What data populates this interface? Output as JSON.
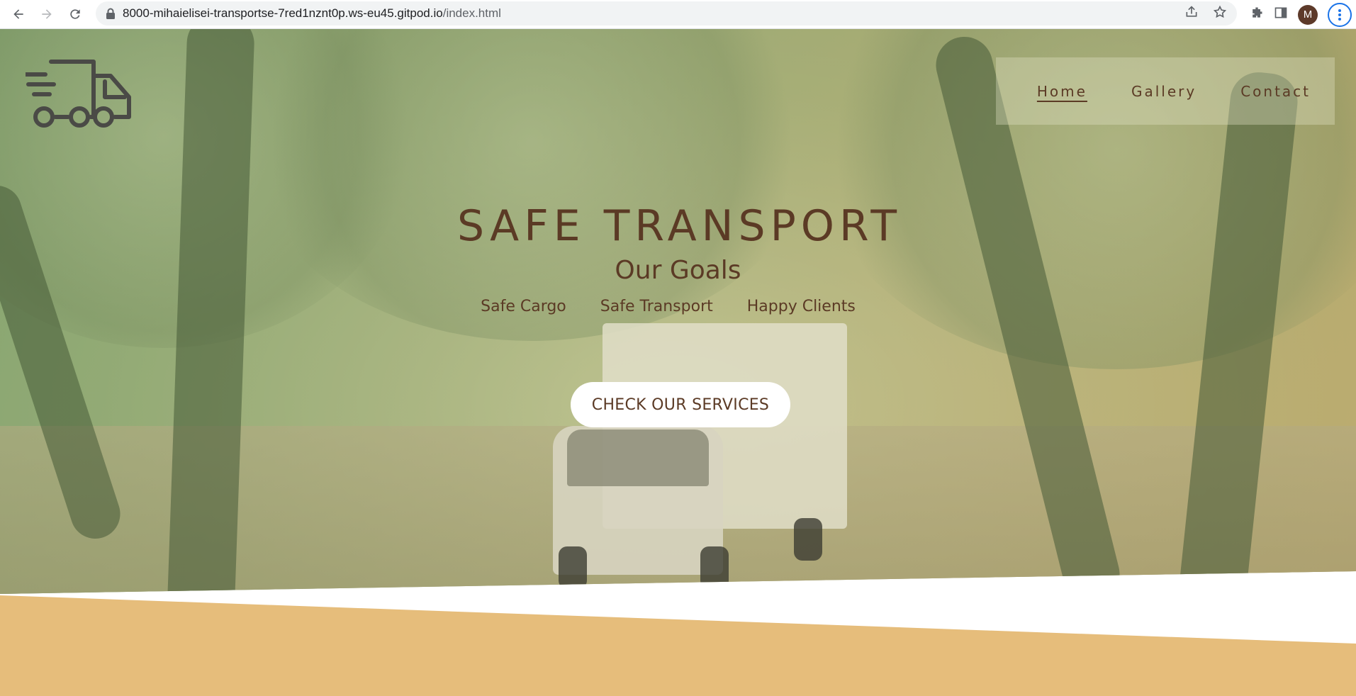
{
  "browser": {
    "url_host": "8000-mihaielisei-transportse-7red1nznt0p.ws-eu45.gitpod.io",
    "url_path": "/index.html",
    "profile_initial": "M",
    "accent_color": "#1a73e8"
  },
  "site": {
    "logo_icon": "delivery-truck-icon",
    "nav": {
      "items": [
        {
          "label": "Home",
          "active": true
        },
        {
          "label": "Gallery",
          "active": false
        },
        {
          "label": "Contact",
          "active": false
        }
      ]
    },
    "hero": {
      "title": "SAFE TRANSPORT",
      "subtitle": "Our Goals",
      "goals": [
        "Safe Cargo",
        "Safe Transport",
        "Happy Clients"
      ],
      "cta_label": "CHECK OUR SERVICES"
    },
    "colors": {
      "text_brown": "#5b3a25",
      "band_tan": "#e6bd7b"
    }
  }
}
